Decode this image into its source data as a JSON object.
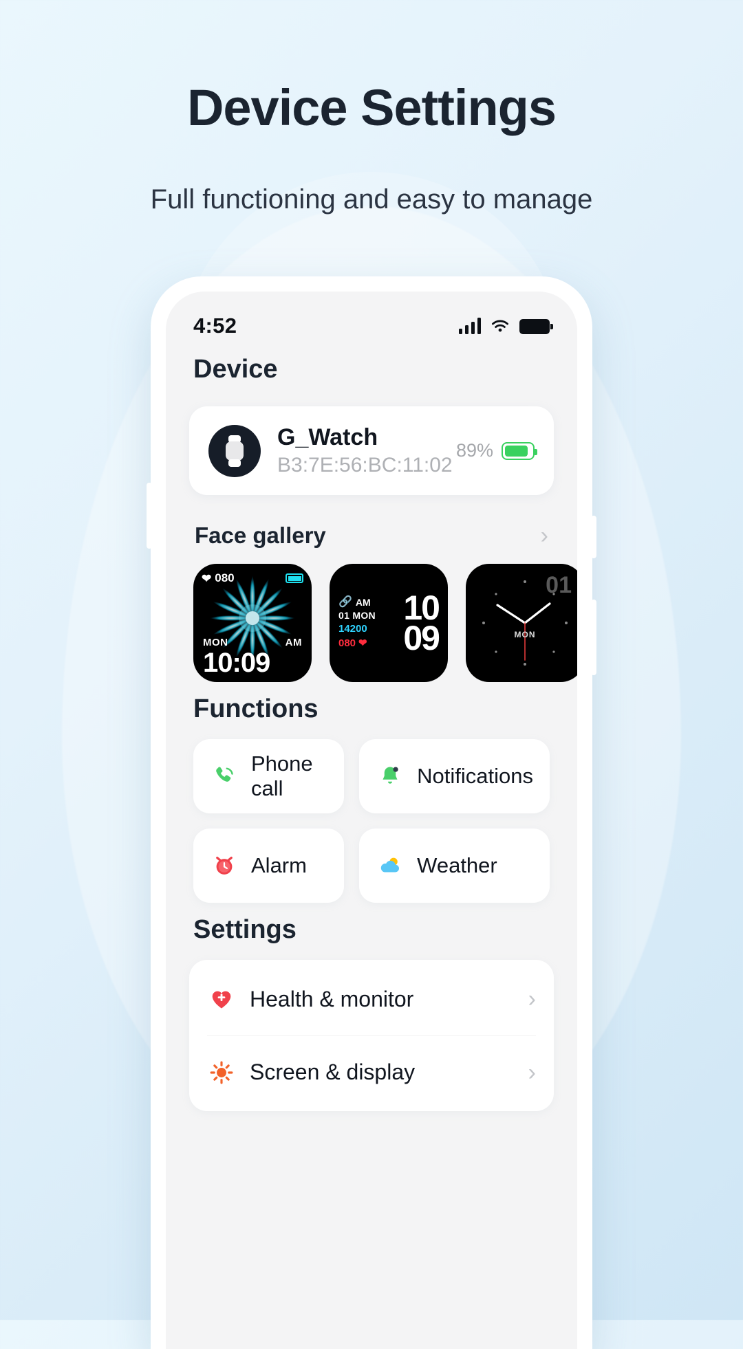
{
  "hero": {
    "title": "Device Settings",
    "subtitle": "Full functioning and easy to manage"
  },
  "statusbar": {
    "time": "4:52",
    "signal_icon": "signal-bars-icon",
    "wifi_icon": "wifi-icon",
    "battery_icon": "battery-full-icon"
  },
  "screen": {
    "device_heading": "Device",
    "device": {
      "name": "G_Watch",
      "mac": "B3:7E:56:BC:11:02",
      "battery_percent": "89%",
      "avatar_icon": "watch-icon",
      "battery_icon": "battery-icon"
    },
    "face_gallery": {
      "title": "Face gallery",
      "chevron": "›",
      "faces": [
        {
          "name": "flower-watch-face",
          "heart_rate": "080",
          "heart_icon": "heart-icon",
          "battery_icon": "battery-icon",
          "day": "MON",
          "meridiem": "AM",
          "time": "10:09"
        },
        {
          "name": "digital-watch-face",
          "link_icon": "link-icon",
          "meridiem": "AM",
          "date": "01 MON",
          "steps": "14200",
          "heart_rate": "080",
          "heart_icon": "heart-icon",
          "hour": "10",
          "minute": "09"
        },
        {
          "name": "analog-watch-face",
          "date": "01",
          "day": "MON"
        }
      ]
    },
    "functions": {
      "title": "Functions",
      "items": [
        {
          "label": "Phone call",
          "icon": "phone-icon"
        },
        {
          "label": "Notifications",
          "icon": "bell-icon"
        },
        {
          "label": "Alarm",
          "icon": "alarm-clock-icon"
        },
        {
          "label": "Weather",
          "icon": "weather-cloud-icon"
        }
      ]
    },
    "settings": {
      "title": "Settings",
      "items": [
        {
          "label": "Health & monitor",
          "icon": "health-heart-icon",
          "chevron": "›"
        },
        {
          "label": "Screen & display",
          "icon": "brightness-icon",
          "chevron": "›"
        }
      ]
    }
  },
  "colors": {
    "accent_green": "#3ad15f",
    "accent_red": "#ff2d3e",
    "accent_cyan": "#2fd3ff",
    "accent_orange": "#f2622a",
    "text_dark": "#11161f"
  }
}
